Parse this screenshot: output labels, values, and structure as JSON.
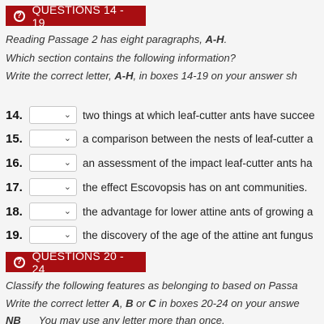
{
  "section1": {
    "title": "QUESTIONS 14 - 19",
    "instr1_pre": "Reading Passage 2 has eight paragraphs, ",
    "instr1_bold": "A-H",
    "instr1_post": ".",
    "instr2": "Which section contains the following information?",
    "instr3_pre": "Write the correct letter, ",
    "instr3_bold": "A-H",
    "instr3_post": ", in boxes 14-19 on your answer sh",
    "questions": [
      {
        "num": "14.",
        "text": "two things at which leaf-cutter ants have succee",
        "selected": ""
      },
      {
        "num": "15.",
        "text": "a comparison between the nests of leaf-cutter a",
        "selected": ""
      },
      {
        "num": "16.",
        "text": "an assessment of the impact leaf-cutter ants ha",
        "selected": ""
      },
      {
        "num": "17.",
        "text": "the effect Escovopsis has on ant communities.",
        "selected": ""
      },
      {
        "num": "18.",
        "text": "the advantage for lower attine ants of growing a",
        "selected": ""
      },
      {
        "num": "19.",
        "text": "the discovery of the age of the attine ant fungus",
        "selected": ""
      }
    ]
  },
  "section2": {
    "title": "QUESTIONS 20 - 24",
    "instr1": "Classify the following features as belonging to based on Passa",
    "instr2_pre": "Write the correct letter ",
    "instr2_a": "A",
    "instr2_sep1": ", ",
    "instr2_b": "B",
    "instr2_sep2": " or ",
    "instr2_c": "C",
    "instr2_post": " in boxes 20-24 on your answe",
    "note_label": "NB",
    "note_text": "You may use any letter more than once."
  },
  "icons": {
    "help": "help-circle-icon",
    "dropdown": "chevron-down-icon"
  },
  "colors": {
    "banner": "#a80e12",
    "background": "#f5f5f5"
  }
}
